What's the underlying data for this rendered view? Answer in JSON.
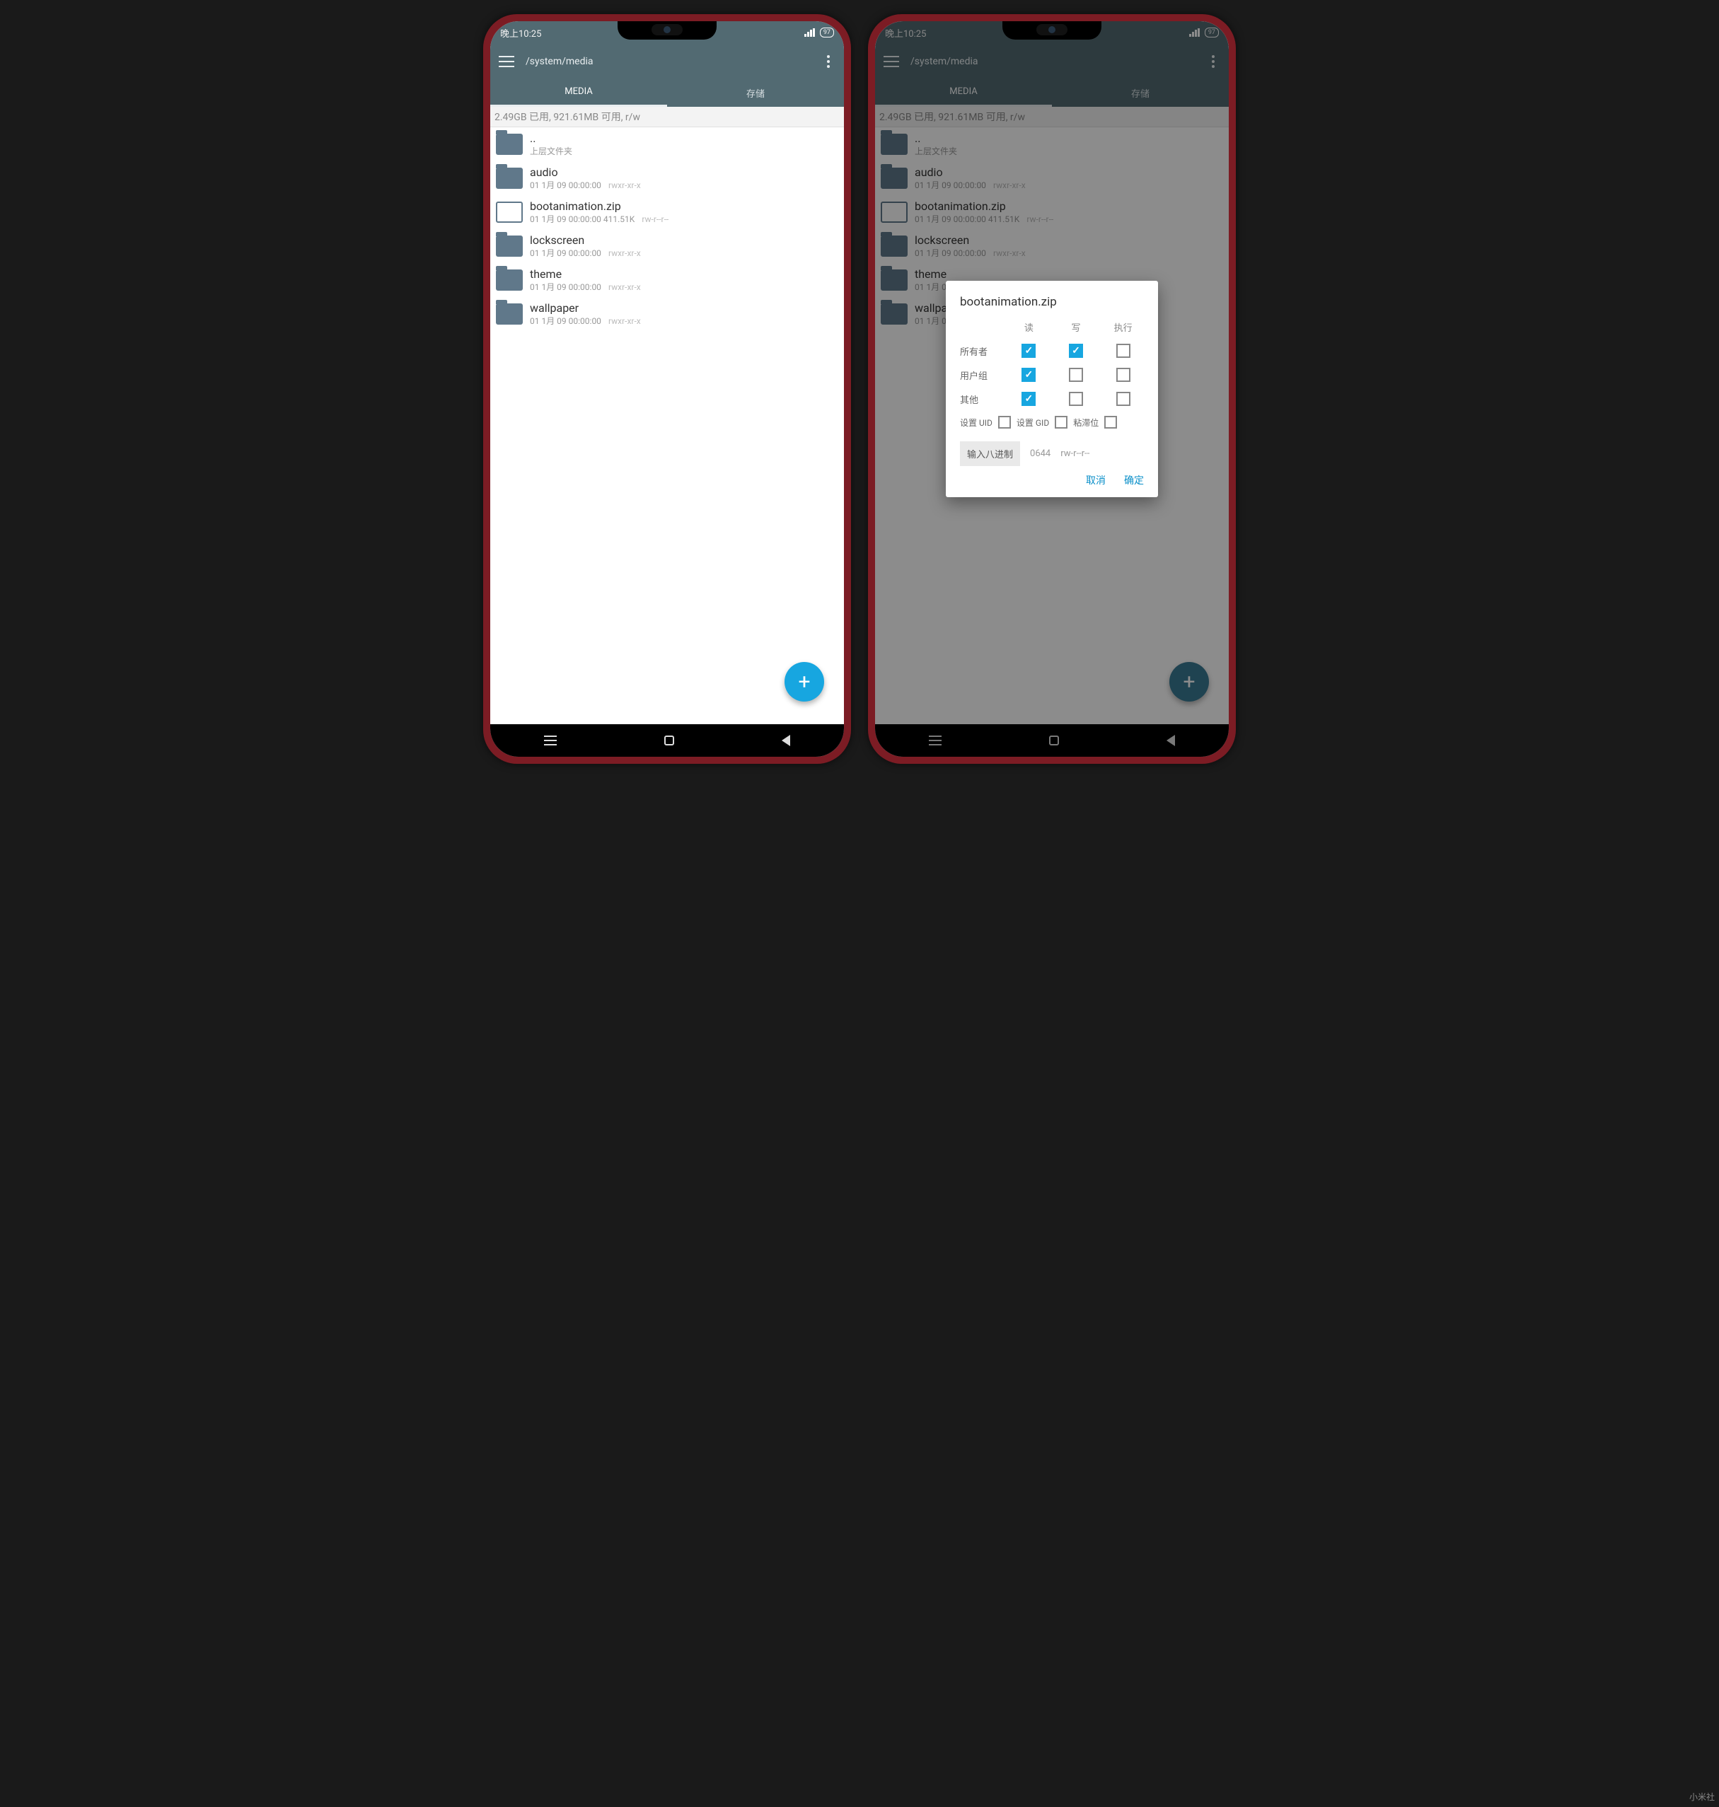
{
  "statusbar": {
    "time": "晚上10:25",
    "battery": "97"
  },
  "appbar": {
    "path": "/system/media"
  },
  "tabs": {
    "left": "MEDIA",
    "right": "存储"
  },
  "storage_line": "2.49GB 已用, 921.61MB 可用, r/w",
  "items": [
    {
      "type": "folder",
      "name": "..",
      "sub": "上层文件夹",
      "perm": ""
    },
    {
      "type": "folder",
      "name": "audio",
      "sub": "01 1月 09 00:00:00",
      "perm": "rwxr-xr-x"
    },
    {
      "type": "file",
      "name": "bootanimation.zip",
      "sub": "01 1月 09 00:00:00   411.51K",
      "perm": "rw-r--r--"
    },
    {
      "type": "folder",
      "name": "lockscreen",
      "sub": "01 1月 09 00:00:00",
      "perm": "rwxr-xr-x"
    },
    {
      "type": "folder",
      "name": "theme",
      "sub": "01 1月 09 00:00:00",
      "perm": "rwxr-xr-x"
    },
    {
      "type": "folder",
      "name": "wallpaper",
      "sub": "01 1月 09 00:00:00",
      "perm": "rwxr-xr-x"
    }
  ],
  "dialog": {
    "title": "bootanimation.zip",
    "headers": {
      "read": "读",
      "write": "写",
      "exec": "执行"
    },
    "rows": [
      {
        "label": "所有者",
        "r": true,
        "w": true,
        "x": false
      },
      {
        "label": "用户组",
        "r": true,
        "w": false,
        "x": false
      },
      {
        "label": "其他",
        "r": true,
        "w": false,
        "x": false
      }
    ],
    "flags": {
      "uid_label": "设置 UID",
      "gid_label": "设置 GID",
      "sticky_label": "粘滞位",
      "uid": false,
      "gid": false,
      "sticky": false
    },
    "octal": {
      "button": "输入八进制",
      "value": "0644",
      "perm": "rw-r--r--"
    },
    "actions": {
      "cancel": "取消",
      "ok": "确定"
    }
  },
  "watermark": "小米社"
}
